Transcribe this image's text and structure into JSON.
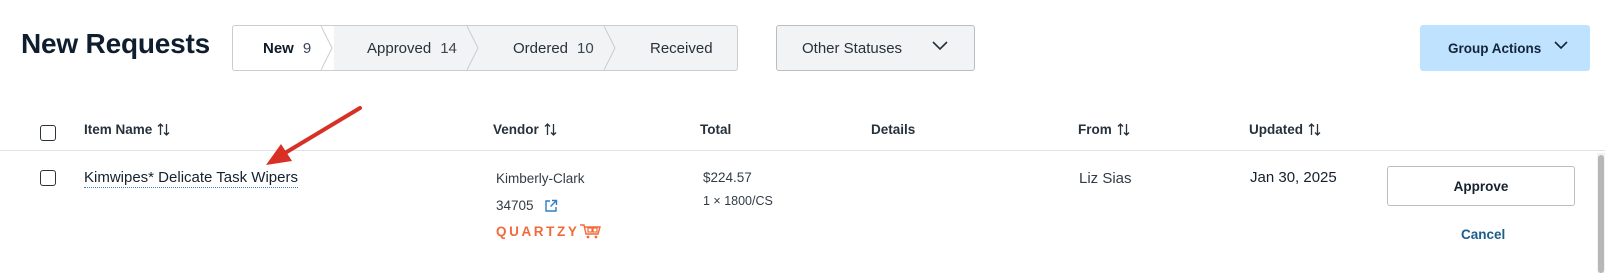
{
  "page": {
    "title": "New Requests"
  },
  "status_tabs": [
    {
      "label": "New",
      "count": "9"
    },
    {
      "label": "Approved",
      "count": "14"
    },
    {
      "label": "Ordered",
      "count": "10"
    },
    {
      "label": "Received",
      "count": ""
    }
  ],
  "other_statuses": {
    "label": "Other Statuses",
    "icon": "chevron-down-icon"
  },
  "group_actions": {
    "label": "Group Actions",
    "icon": "chevron-down-icon"
  },
  "table": {
    "columns": [
      {
        "label": "Item Name",
        "sortable": true
      },
      {
        "label": "Vendor",
        "sortable": true
      },
      {
        "label": "Total",
        "sortable": false
      },
      {
        "label": "Details",
        "sortable": false
      },
      {
        "label": "From",
        "sortable": true
      },
      {
        "label": "Updated",
        "sortable": true
      }
    ],
    "rows": [
      {
        "item_name": "Kimwipes* Delicate Task Wipers",
        "vendor": "Kimberly-Clark",
        "catalog_number": "34705",
        "vendor_badge": "QUARTZY",
        "total": "$224.57",
        "unit": "1 × 1800/CS",
        "details": "",
        "from": "Liz Sias",
        "updated": "Jan 30, 2025",
        "approve_label": "Approve",
        "cancel_label": "Cancel"
      }
    ]
  },
  "colors": {
    "accent_blue": "#bfe2ff",
    "link_blue": "#1c5e89",
    "quartzy_orange": "#f06a3b",
    "annotation_red": "#d93025"
  },
  "icons": [
    "sort-icon",
    "chevron-down-icon",
    "external-link-icon",
    "quartzy-cart-icon",
    "annotation-arrow"
  ]
}
